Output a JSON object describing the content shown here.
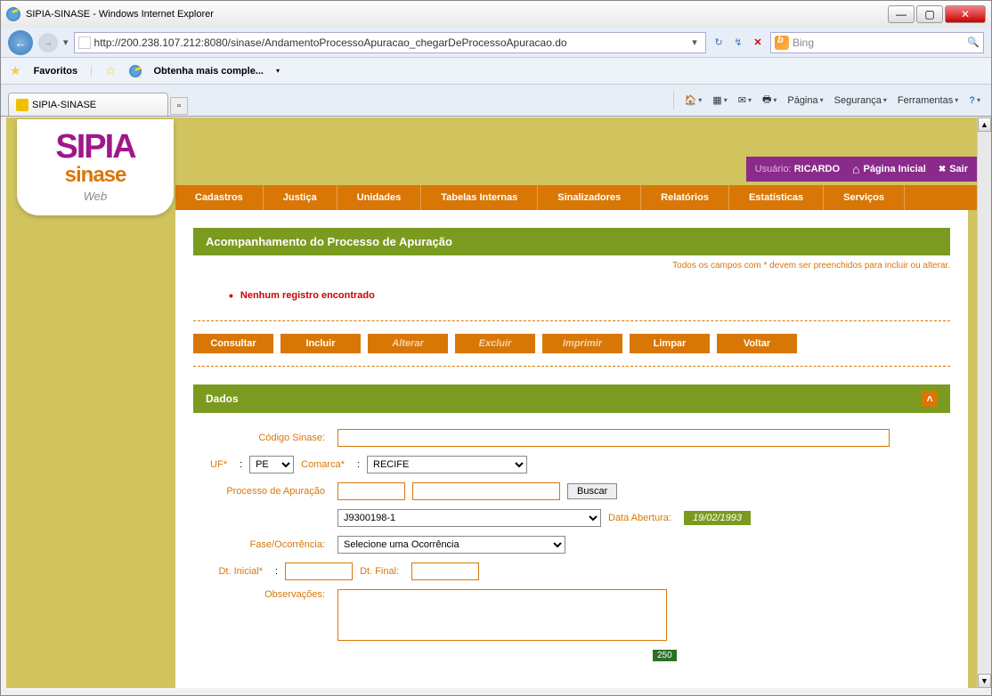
{
  "window": {
    "title": "SIPIA-SINASE - Windows Internet Explorer",
    "url": "http://200.238.107.212:8080/sinase/AndamentoProcessoApuracao_chegarDeProcessoApuracao.do",
    "search_engine": "Bing"
  },
  "ie": {
    "favorites_label": "Favoritos",
    "suggested_sites": "Obtenha mais comple...",
    "tab_title": "SIPIA-SINASE",
    "menu": {
      "page": "Página",
      "security": "Segurança",
      "tools": "Ferramentas"
    }
  },
  "app": {
    "logo": {
      "line1": "SIPIA",
      "line2": "sinase",
      "line3": "Web"
    },
    "user_label": "Usuário:",
    "user_name": "RICARDO",
    "home_label": "Página Inicial",
    "exit_label": "Sair",
    "menu": [
      "Cadastros",
      "Justiça",
      "Unidades",
      "Tabelas Internas",
      "Sinalizadores",
      "Relatórios",
      "Estatísticas",
      "Serviços"
    ]
  },
  "page": {
    "title": "Acompanhamento do Processo de Apuração",
    "required_note": "Todos os campos com * devem ser preenchidos para incluir ou alterar.",
    "error": "Nenhum registro encontrado",
    "buttons": {
      "consultar": "Consultar",
      "incluir": "Incluir",
      "alterar": "Alterar",
      "excluir": "Excluir",
      "imprimir": "Imprimir",
      "limpar": "Limpar",
      "voltar": "Voltar"
    }
  },
  "form": {
    "section": "Dados",
    "codigo_label": "Código Sinase:",
    "codigo_value": "",
    "uf_label": "UF",
    "uf_value": "PE",
    "comarca_label": "Comarca",
    "comarca_value": "RECIFE",
    "processo_label": "Processo de Apuração",
    "processo_inp1": "",
    "processo_inp2": "",
    "buscar": "Buscar",
    "processo_sel": "J9300198-1",
    "data_abertura_label": "Data Abertura:",
    "data_abertura_value": "19/02/1993",
    "fase_label": "Fase/Ocorrência:",
    "fase_value": "Selecione uma Ocorrência",
    "dt_inicial_label": "Dt. Inicial",
    "dt_inicial_value": "",
    "dt_final_label": "Dt. Final:",
    "dt_final_value": "",
    "obs_label": "Observações:",
    "obs_value": "",
    "counter": "250"
  }
}
